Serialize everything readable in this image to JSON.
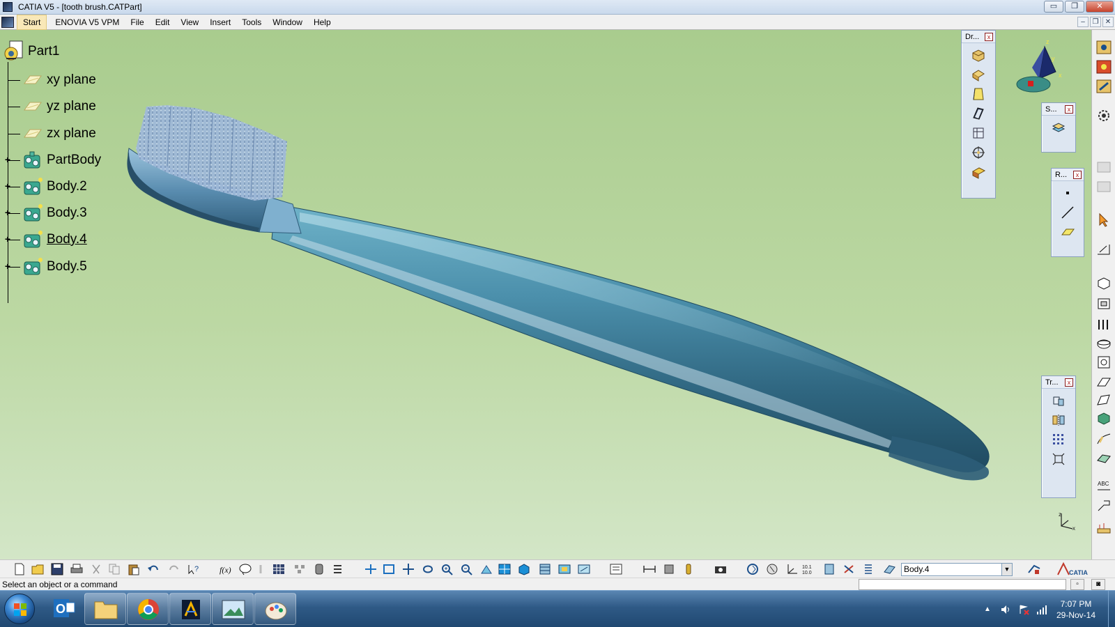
{
  "window": {
    "title": "CATIA V5 - [tooth brush.CATPart]",
    "controls": {
      "minimize": "▭",
      "restore": "❐",
      "close": "✕"
    }
  },
  "menubar": {
    "items": [
      "Start",
      "ENOVIA V5 VPM",
      "File",
      "Edit",
      "View",
      "Insert",
      "Tools",
      "Window",
      "Help"
    ],
    "mdi_controls": {
      "minimize": "–",
      "restore": "❐",
      "close": "✕"
    }
  },
  "tree": {
    "root": "Part1",
    "nodes": [
      {
        "label": "xy plane",
        "type": "plane"
      },
      {
        "label": "yz plane",
        "type": "plane"
      },
      {
        "label": "zx plane",
        "type": "plane"
      },
      {
        "label": "PartBody",
        "type": "body",
        "expandable": true
      },
      {
        "label": "Body.2",
        "type": "body",
        "expandable": true
      },
      {
        "label": "Body.3",
        "type": "body",
        "expandable": true
      },
      {
        "label": "Body.4",
        "type": "body",
        "expandable": true,
        "current": true
      },
      {
        "label": "Body.5",
        "type": "body",
        "expandable": true
      }
    ],
    "expander": "+"
  },
  "floating_toolbars": {
    "dress_up": {
      "title": "Dr...",
      "close": "x",
      "tools": [
        "shaded-cube-icon",
        "fillet-icon",
        "draft-icon",
        "shell-icon",
        "thickness-icon",
        "thread-icon",
        "remove-face-icon"
      ]
    },
    "surface": {
      "title": "S...",
      "close": "x",
      "tools": [
        "surface-stack-icon"
      ]
    },
    "reference": {
      "title": "R...",
      "close": "x",
      "tools": [
        "point-icon",
        "line-icon",
        "plane-icon"
      ]
    },
    "transform": {
      "title": "Tr...",
      "close": "x",
      "tools": [
        "translate-icon",
        "mirror-icon",
        "pattern-icon",
        "scale-icon"
      ]
    }
  },
  "bottom_toolbar": {
    "current_body": "Body.4",
    "dropdown_arrow": "▼",
    "zoom_label": "10.1 10.0"
  },
  "statusbar": {
    "message": "Select an object or a command"
  },
  "taskbar": {
    "apps": [
      "outlook-icon",
      "explorer-icon",
      "chrome-icon",
      "catia-icon",
      "photo-viewer-icon",
      "paint-icon"
    ],
    "time": "7:07 PM",
    "date": "29-Nov-14"
  },
  "compass": {
    "axis_z": "z",
    "axis_x": "x",
    "axis_y": "y"
  },
  "colors": {
    "viewport_top": "#a9cc8e",
    "viewport_bottom": "#d3e6c7",
    "brush_handle": "#3f7e9a",
    "bristles": "#8aa9cf"
  }
}
